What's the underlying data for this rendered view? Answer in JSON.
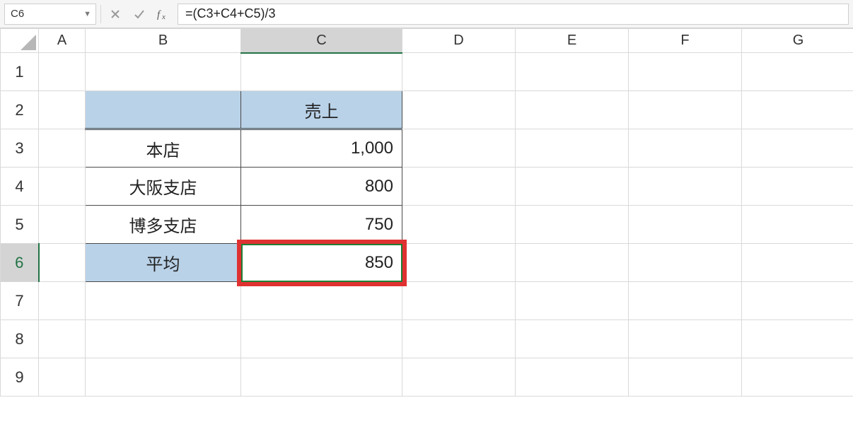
{
  "formula_bar": {
    "cell_ref": "C6",
    "formula": "=(C3+C4+C5)/3"
  },
  "columns": [
    "A",
    "B",
    "C",
    "D",
    "E",
    "F",
    "G"
  ],
  "rows": [
    "1",
    "2",
    "3",
    "4",
    "5",
    "6",
    "7",
    "8",
    "9"
  ],
  "table": {
    "header_col": "",
    "header_val": "売上",
    "rows": [
      {
        "label": "本店",
        "value": "1,000"
      },
      {
        "label": "大阪支店",
        "value": "800"
      },
      {
        "label": "博多支店",
        "value": "750"
      }
    ],
    "footer_label": "平均",
    "footer_value": "850"
  },
  "active_cell": "C6"
}
